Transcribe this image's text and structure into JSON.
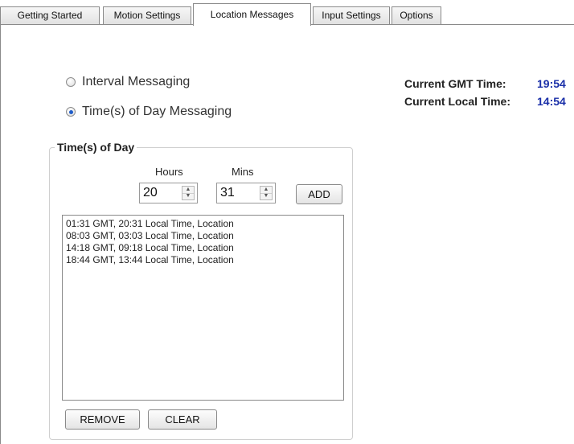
{
  "tabs": [
    {
      "label": "Getting Started"
    },
    {
      "label": "Motion Settings"
    },
    {
      "label": "Location Messages",
      "active": true
    },
    {
      "label": "Input Settings"
    },
    {
      "label": "Options"
    }
  ],
  "messaging_mode": {
    "options": [
      {
        "label": "Interval Messaging",
        "checked": false
      },
      {
        "label": "Time(s) of Day Messaging",
        "checked": true
      }
    ]
  },
  "time_info": {
    "gmt_label": "Current GMT Time:",
    "gmt_value": "19:54",
    "local_label": "Current Local Time:",
    "local_value": "14:54"
  },
  "times_of_day": {
    "title": "Time(s) of Day",
    "hours_label": "Hours",
    "mins_label": "Mins",
    "hours_value": "20",
    "mins_value": "31",
    "add_label": "ADD",
    "entries": [
      "01:31 GMT, 20:31 Local Time, Location",
      "08:03 GMT, 03:03 Local Time, Location",
      "14:18 GMT, 09:18 Local Time, Location",
      "18:44 GMT, 13:44 Local Time, Location"
    ],
    "remove_label": "REMOVE",
    "clear_label": "CLEAR"
  },
  "colors": {
    "time_value": "#1a2fa8",
    "radio_selected": "#1e5cc8"
  }
}
